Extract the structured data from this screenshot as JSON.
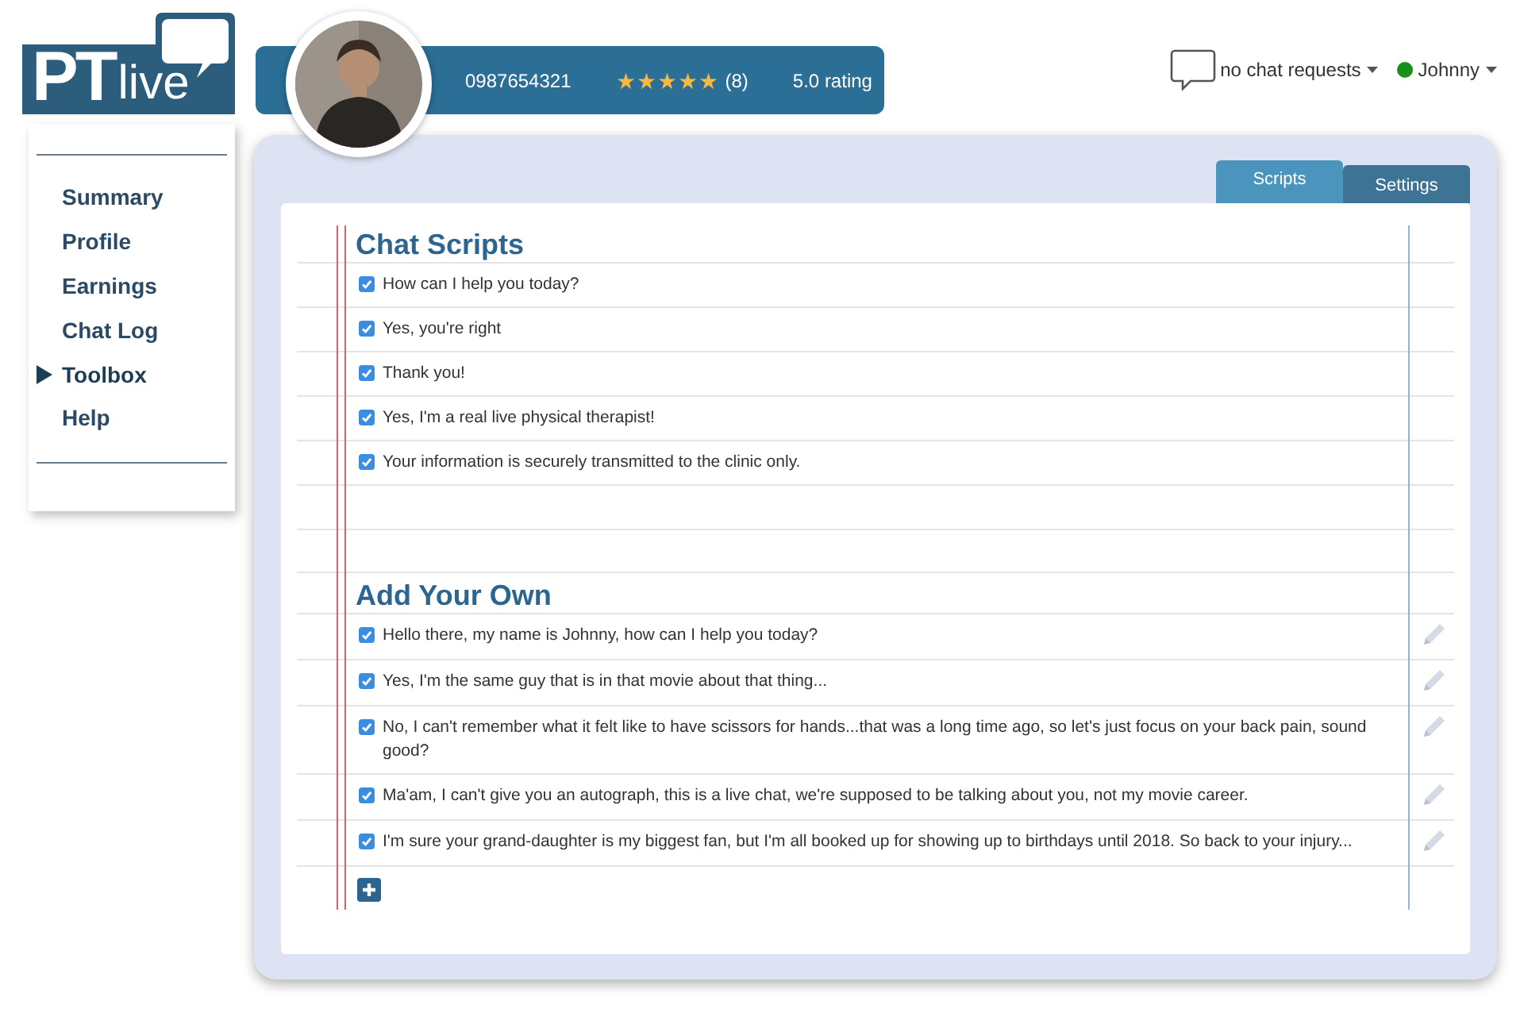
{
  "logo": {
    "bold": "PT",
    "light": "live"
  },
  "profile": {
    "phone": "0987654321",
    "stars": 5,
    "star_char": "★",
    "reviews": "(8)",
    "rating": "5.0 rating"
  },
  "top_bar": {
    "chat_requests": "no chat requests",
    "user": "Johnny",
    "online": true
  },
  "sidebar": {
    "items": [
      {
        "label": "Summary",
        "selected": false
      },
      {
        "label": "Profile",
        "selected": false
      },
      {
        "label": "Earnings",
        "selected": false
      },
      {
        "label": "Chat Log",
        "selected": false
      },
      {
        "label": "Toolbox",
        "selected": true
      },
      {
        "label": "Help",
        "selected": false
      }
    ]
  },
  "tabs": [
    {
      "label": "Scripts",
      "selected": true
    },
    {
      "label": "Settings",
      "selected": false
    }
  ],
  "sections": [
    {
      "title": "Chat Scripts",
      "editable": false,
      "items": [
        {
          "text": "How can I help you today?",
          "checked": true
        },
        {
          "text": "Yes, you're right",
          "checked": true
        },
        {
          "text": "Thank you!",
          "checked": true
        },
        {
          "text": "Yes, I'm a real live physical therapist!",
          "checked": true
        },
        {
          "text": "Your information is securely transmitted to the clinic only.",
          "checked": true
        }
      ]
    },
    {
      "title": "Add Your Own",
      "editable": true,
      "items": [
        {
          "text": "Hello there, my name is Johnny, how can I help you today?",
          "checked": true
        },
        {
          "text": "Yes, I'm the same guy that is in that movie about that thing...",
          "checked": true
        },
        {
          "text": "No, I can't remember what it felt like to have scissors for hands...that was a long time ago, so let's just focus on your back pain, sound good?",
          "checked": true
        },
        {
          "text": "Ma'am, I can't give you an autograph, this is a live chat, we're supposed to be talking about you, not my movie career.",
          "checked": true
        },
        {
          "text": "I'm sure your grand-daughter is my biggest fan, but I'm all booked up for showing up to birthdays until 2018. So back to your injury...",
          "checked": true
        }
      ]
    }
  ]
}
